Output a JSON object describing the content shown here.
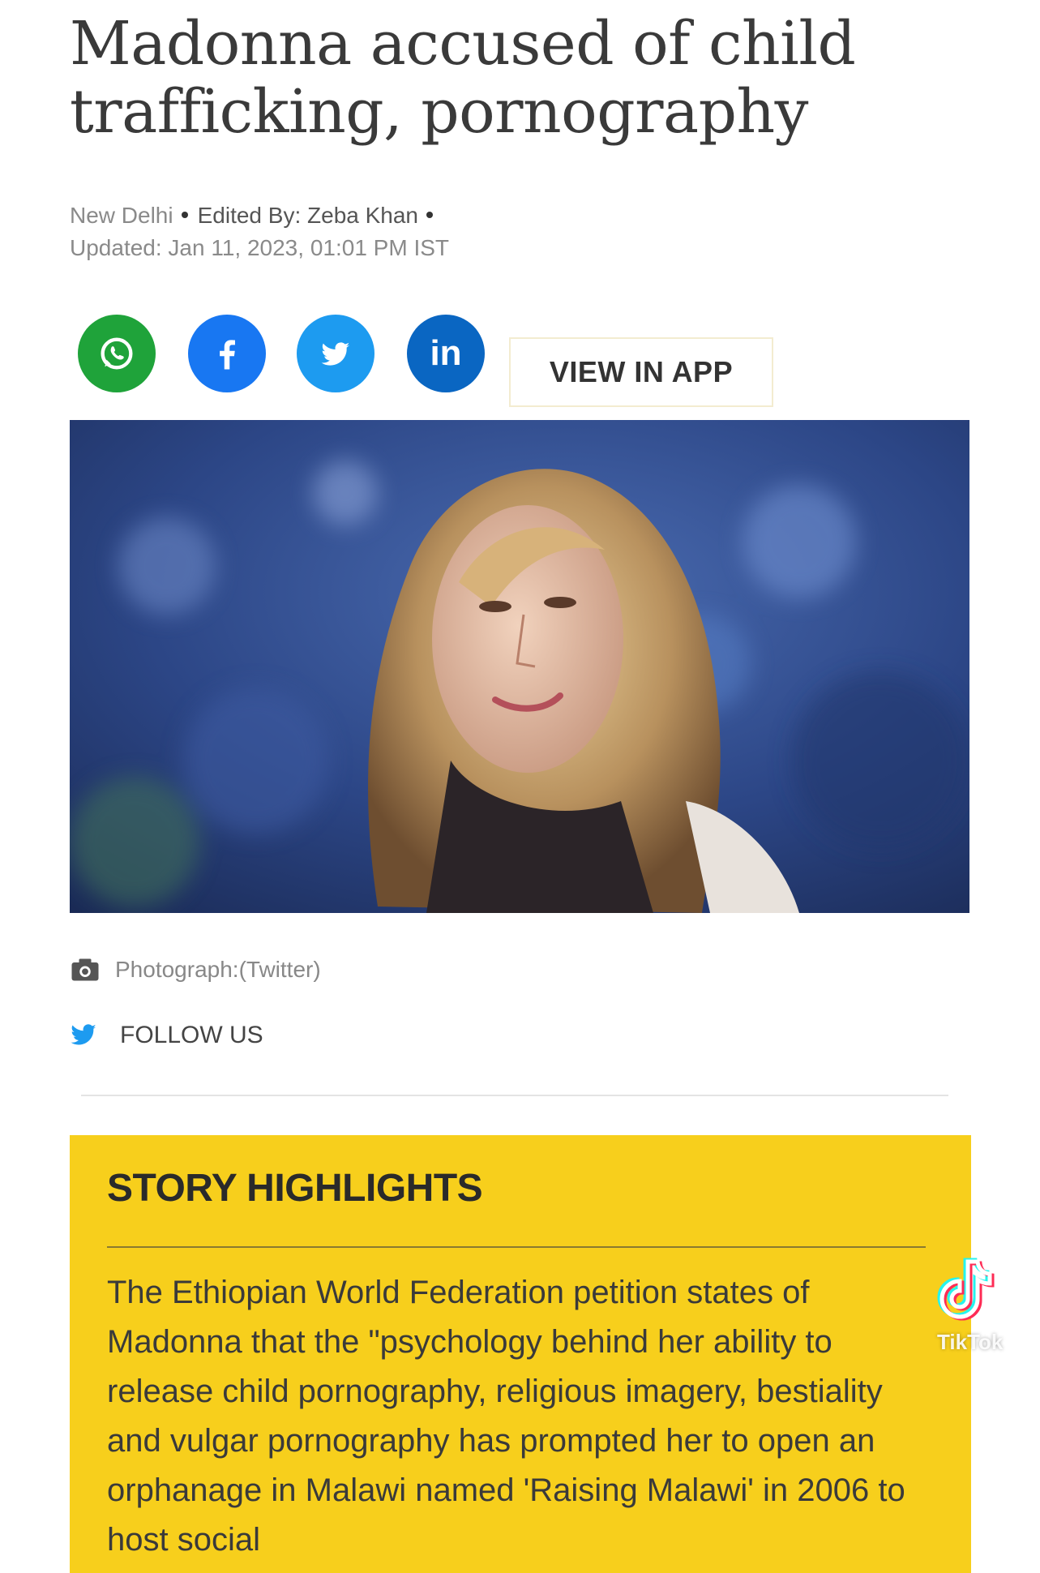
{
  "article": {
    "headline": "Madonna accused of child trafficking, pornography",
    "meta": {
      "location": "New Delhi",
      "edited_by": "Edited By: Zeba Khan",
      "updated": "Updated: Jan 11, 2023, 01:01 PM IST"
    },
    "share": {
      "whatsapp_icon": "whatsapp-icon",
      "facebook_icon": "facebook-icon",
      "twitter_icon": "twitter-icon",
      "linkedin_icon": "linkedin-icon",
      "linkedin_text": "in",
      "view_in_app": "VIEW IN APP"
    },
    "photo_caption": "Photograph:(Twitter)",
    "follow_us": "FOLLOW US",
    "story_highlights": {
      "title": "STORY HIGHLIGHTS",
      "text": "The Ethiopian World Federation petition states of Madonna that the \"psychology behind her ability to release child pornography, religious imagery, bestiality and vulgar pornography has prompted her to open an orphanage in Malawi named 'Raising Malawi' in 2006 to host social"
    }
  },
  "watermark": {
    "label": "TikTok"
  },
  "colors": {
    "whatsapp": "#1fa33a",
    "facebook": "#1877f2",
    "twitter": "#1d9bf0",
    "linkedin": "#0a66c2",
    "highlights_bg": "#f7cf1c"
  }
}
